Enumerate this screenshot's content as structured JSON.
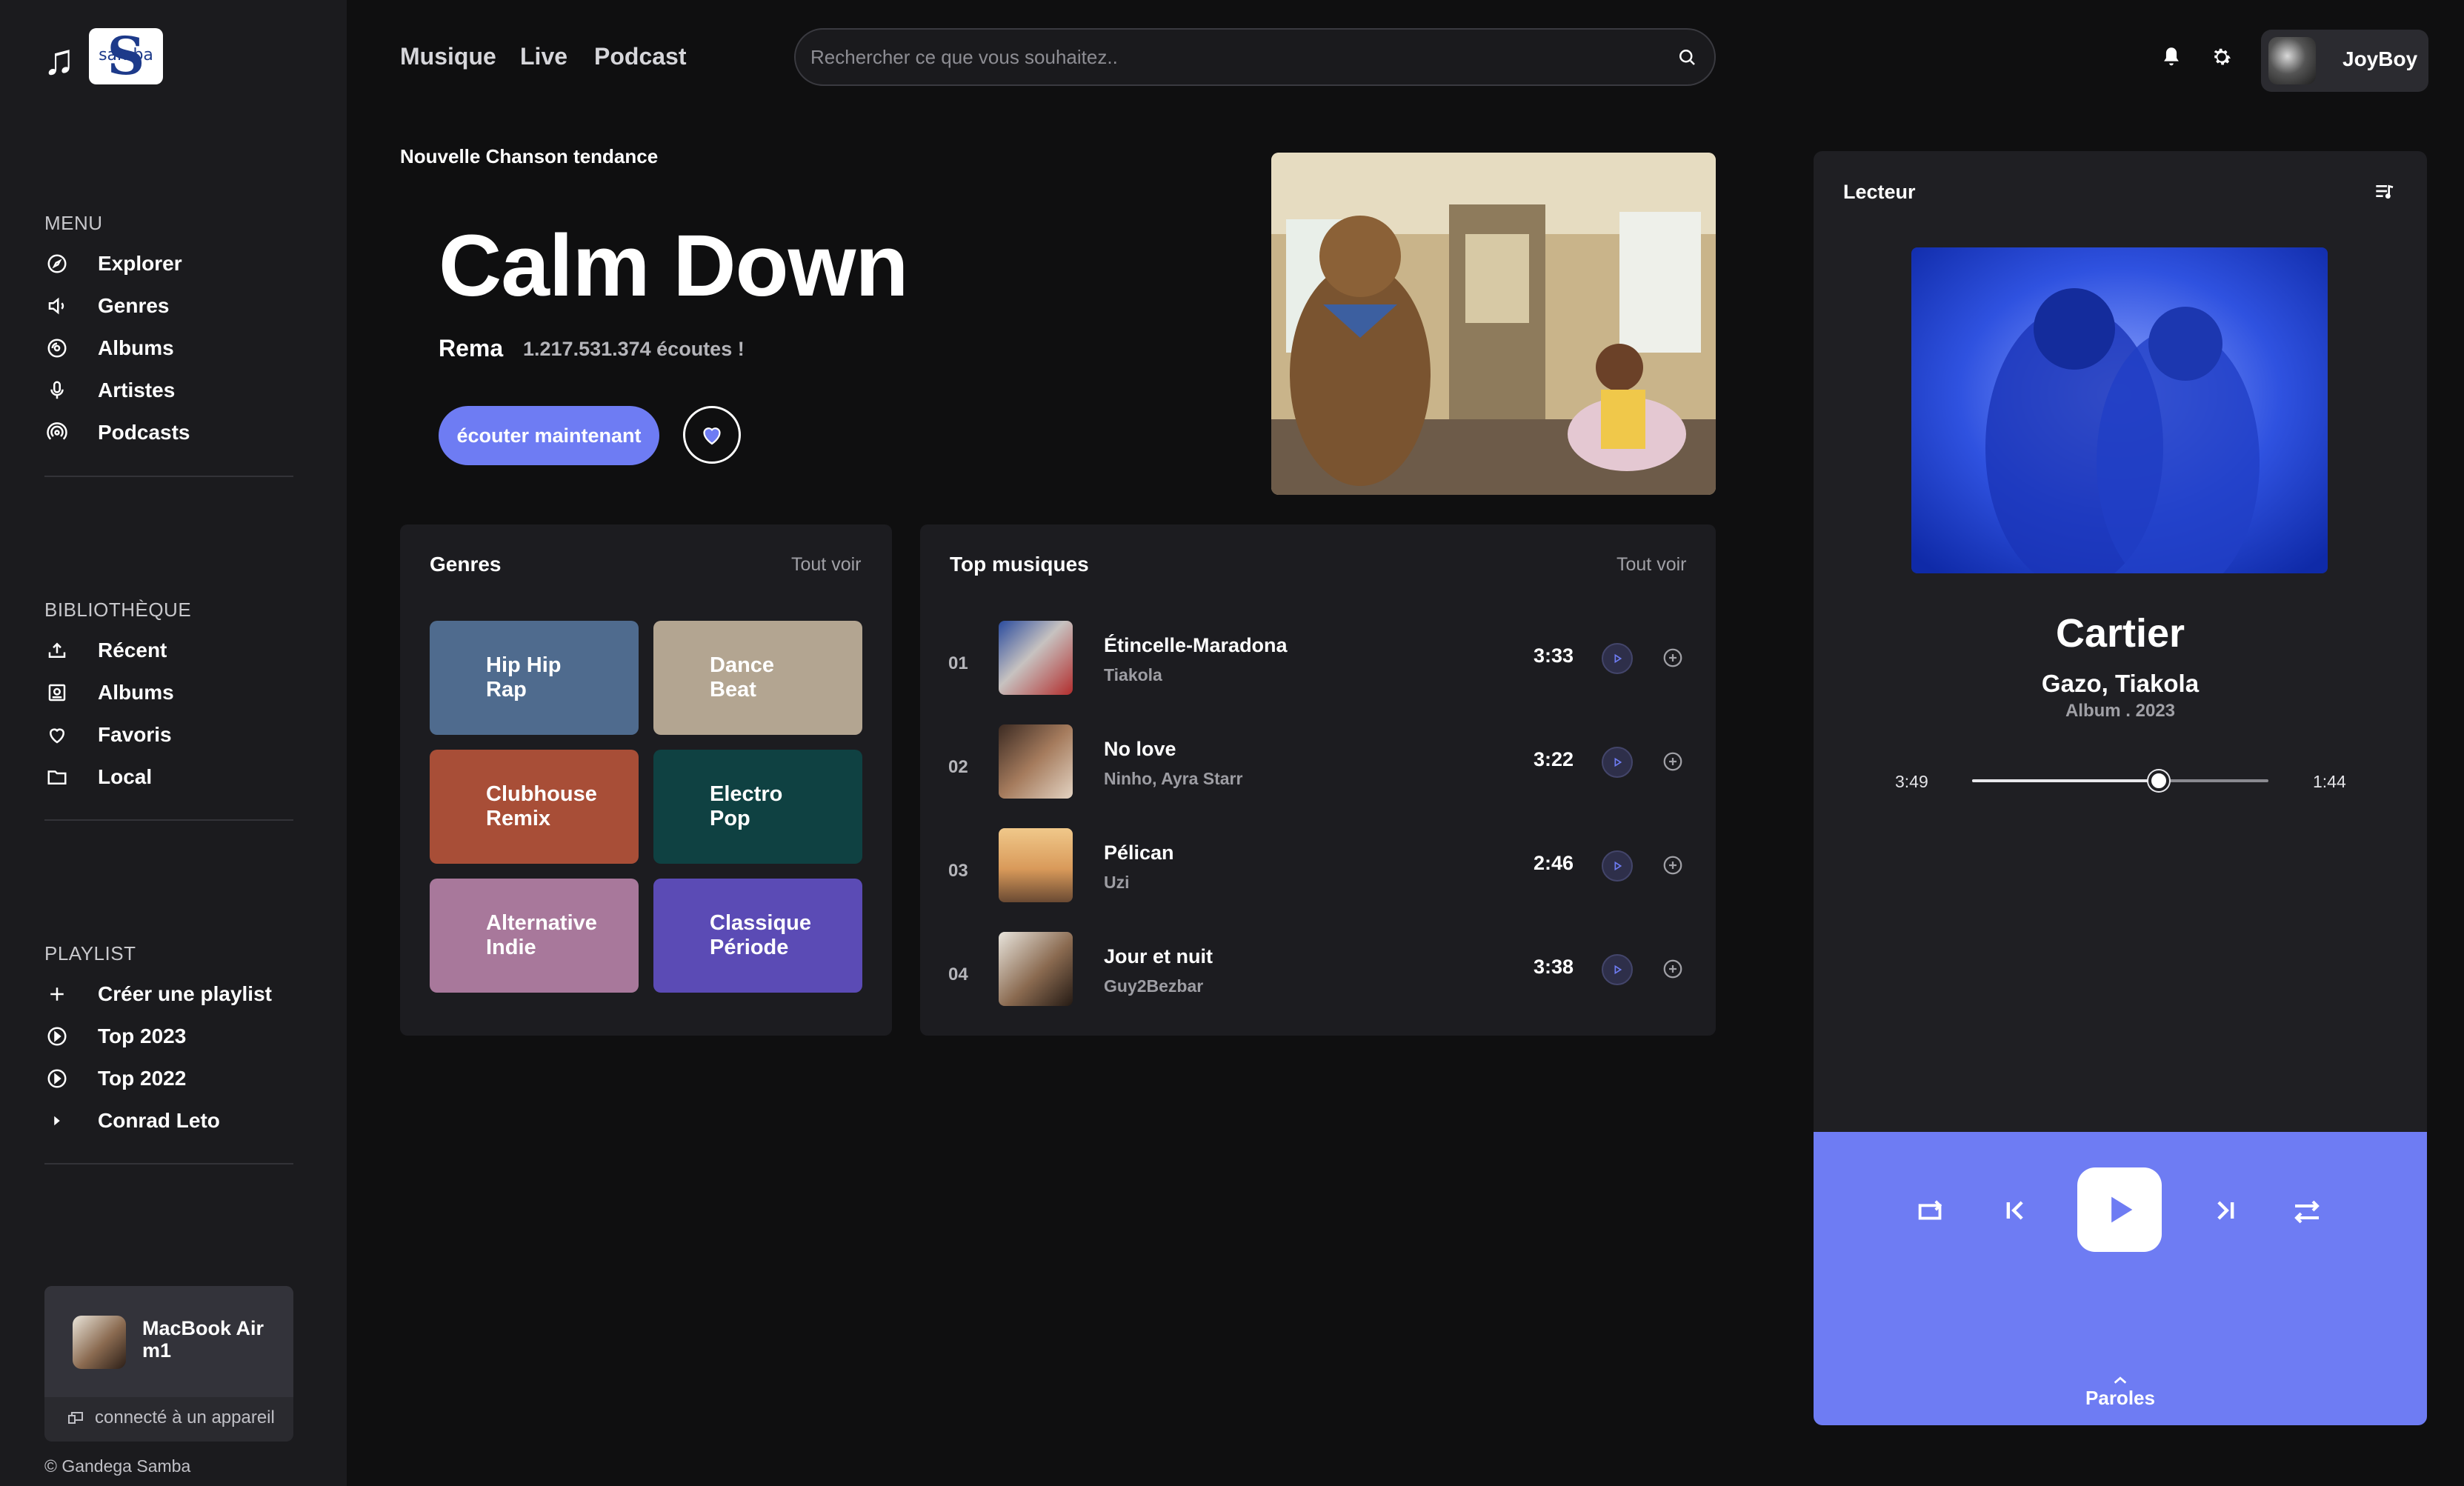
{
  "brand": {
    "logo_text": "samba",
    "logo_letter": "S"
  },
  "sidebar": {
    "menu_title": "MENU",
    "menu": [
      {
        "label": "Explorer",
        "icon": "compass-icon"
      },
      {
        "label": "Genres",
        "icon": "speaker-icon"
      },
      {
        "label": "Albums",
        "icon": "disc-icon"
      },
      {
        "label": "Artistes",
        "icon": "microphone-icon"
      },
      {
        "label": "Podcasts",
        "icon": "podcast-icon"
      }
    ],
    "library_title": "BIBLIOTHÈQUE",
    "library": [
      {
        "label": "Récent",
        "icon": "upload-icon"
      },
      {
        "label": "Albums",
        "icon": "album-icon"
      },
      {
        "label": "Favoris",
        "icon": "heart-icon"
      },
      {
        "label": "Local",
        "icon": "folder-icon"
      }
    ],
    "playlist_title": "PLAYLIST",
    "playlists": [
      {
        "label": "Créer une playlist",
        "icon": "plus-icon"
      },
      {
        "label": "Top 2023",
        "icon": "play-circle-icon"
      },
      {
        "label": "Top 2022",
        "icon": "play-circle-icon"
      },
      {
        "label": "Conrad Leto",
        "icon": "caret-right-icon"
      }
    ],
    "device": {
      "name": "MacBook Air m1",
      "status": "connecté à un appareil"
    },
    "copyright": "© Gandega Samba"
  },
  "header": {
    "nav": [
      "Musique",
      "Live",
      "Podcast"
    ],
    "search_placeholder": "Rechercher ce que vous souhaitez..",
    "user_name": "JoyBoy"
  },
  "hero": {
    "kicker": "Nouvelle Chanson tendance",
    "title": "Calm Down",
    "artist": "Rema",
    "plays": "1.217.531.374 écoutes !",
    "cta": "écouter maintenant"
  },
  "genres_card": {
    "title": "Genres",
    "see_all": "Tout voir",
    "items": [
      {
        "label": "Hip Hip\nRap",
        "color": "#4f6b8e"
      },
      {
        "label": "Dance\nBeat",
        "color": "#b3a591"
      },
      {
        "label": "Clubhouse\nRemix",
        "color": "#a84e37"
      },
      {
        "label": "Electro\nPop",
        "color": "#0f4142"
      },
      {
        "label": "Alternative\nIndie",
        "color": "#a8789b"
      },
      {
        "label": "Classique\nPériode",
        "color": "#5b4bb5"
      }
    ]
  },
  "top_card": {
    "title": "Top musiques",
    "see_all": "Tout voir",
    "tracks": [
      {
        "num": "01",
        "title": "Étincelle-Maradona",
        "artist": "Tiakola",
        "duration": "3:33"
      },
      {
        "num": "02",
        "title": "No love",
        "artist": "Ninho, Ayra Starr",
        "duration": "3:22"
      },
      {
        "num": "03",
        "title": "Pélican",
        "artist": "Uzi",
        "duration": "2:46"
      },
      {
        "num": "04",
        "title": "Jour et nuit",
        "artist": "Guy2Bezbar",
        "duration": "3:38"
      }
    ]
  },
  "player": {
    "title": "Lecteur",
    "song": "Cartier",
    "artist": "Gazo, Tiakola",
    "album": "Album . 2023",
    "elapsed": "3:49",
    "remaining": "1:44",
    "progress": 0.63,
    "lyrics_label": "Paroles"
  },
  "colors": {
    "accent": "#6e7cf3",
    "background": "#0f0f10",
    "sidebar": "#1b1b1e",
    "card": "#1c1c20"
  }
}
